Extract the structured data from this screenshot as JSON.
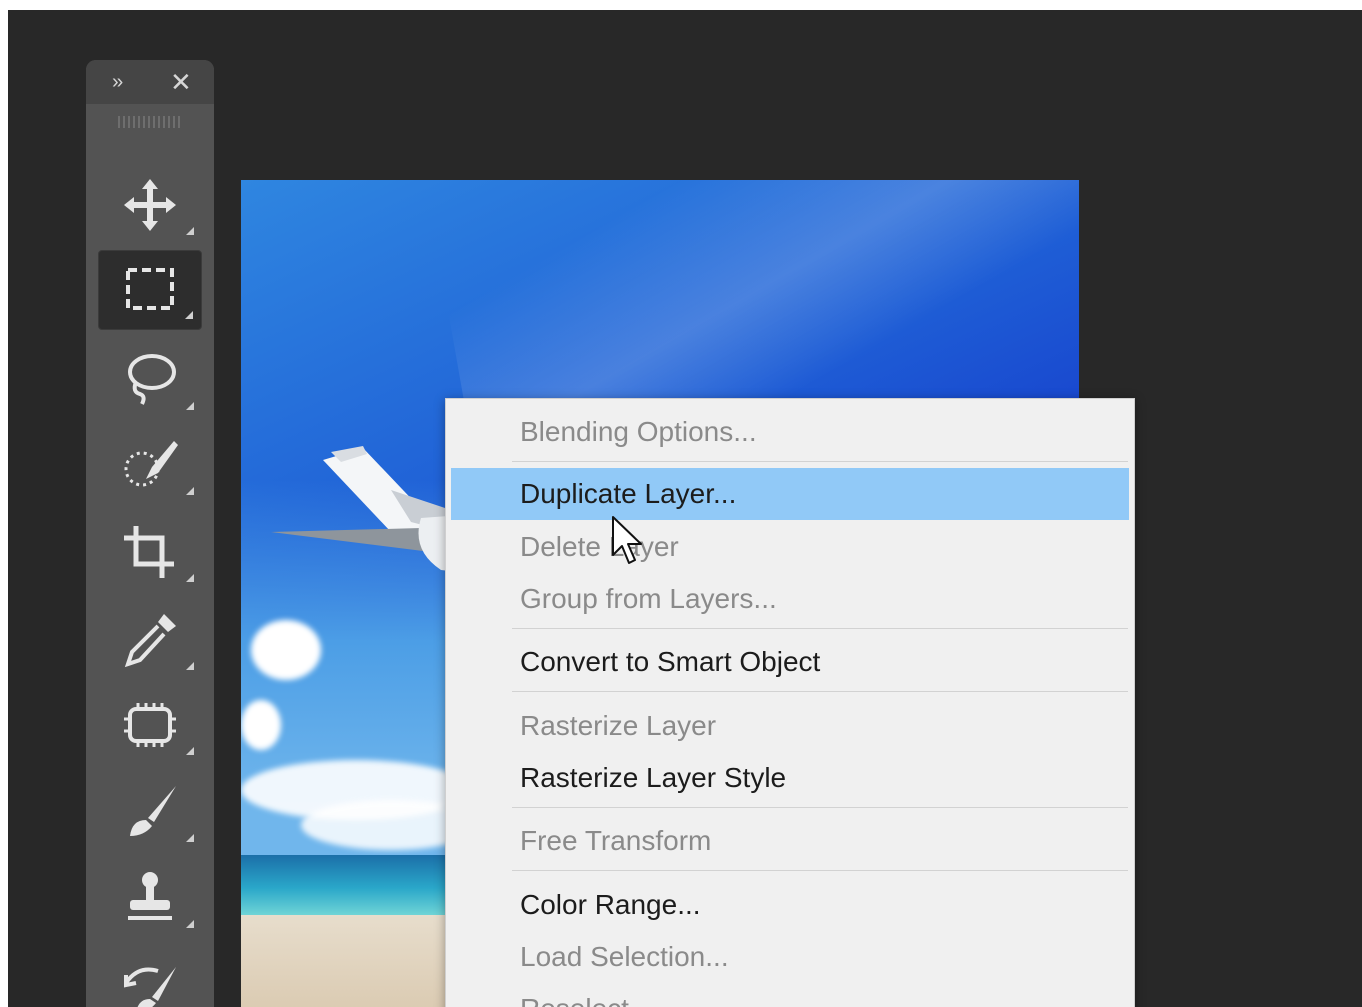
{
  "toolbar": {
    "collapse_label": "››",
    "close_label": "✕",
    "tools": [
      {
        "name": "move-tool",
        "icon": "move-icon"
      },
      {
        "name": "rectangular-marquee-tool",
        "icon": "marquee-icon",
        "selected": true
      },
      {
        "name": "lasso-tool",
        "icon": "lasso-icon"
      },
      {
        "name": "quick-selection-tool",
        "icon": "quick-selection-icon"
      },
      {
        "name": "crop-tool",
        "icon": "crop-icon"
      },
      {
        "name": "eyedropper-tool",
        "icon": "eyedropper-icon"
      },
      {
        "name": "spot-healing-tool",
        "icon": "bandage-icon"
      },
      {
        "name": "brush-tool",
        "icon": "brush-icon"
      },
      {
        "name": "clone-stamp-tool",
        "icon": "stamp-icon"
      },
      {
        "name": "history-brush-tool",
        "icon": "history-brush-icon"
      }
    ]
  },
  "context_menu": {
    "items": [
      {
        "label": "Blending Options...",
        "state": "disabled"
      },
      {
        "label": "Duplicate Layer...",
        "state": "highlighted"
      },
      {
        "label": "Delete Layer",
        "state": "disabled"
      },
      {
        "label": "Group from Layers...",
        "state": "disabled"
      },
      {
        "label": "Convert to Smart Object",
        "state": "enabled"
      },
      {
        "label": "Rasterize Layer",
        "state": "disabled"
      },
      {
        "label": "Rasterize Layer Style",
        "state": "enabled"
      },
      {
        "label": "Free Transform",
        "state": "disabled"
      },
      {
        "label": "Color Range...",
        "state": "enabled"
      },
      {
        "label": "Load Selection...",
        "state": "disabled"
      },
      {
        "label": "Reselect",
        "state": "disabled"
      }
    ]
  },
  "colors": {
    "workspace_bg": "#282828",
    "toolbar_bg": "#535353",
    "menu_bg": "#f0f0f0",
    "menu_highlight": "#91c9f7",
    "menu_disabled_text": "#8a8a8a"
  }
}
